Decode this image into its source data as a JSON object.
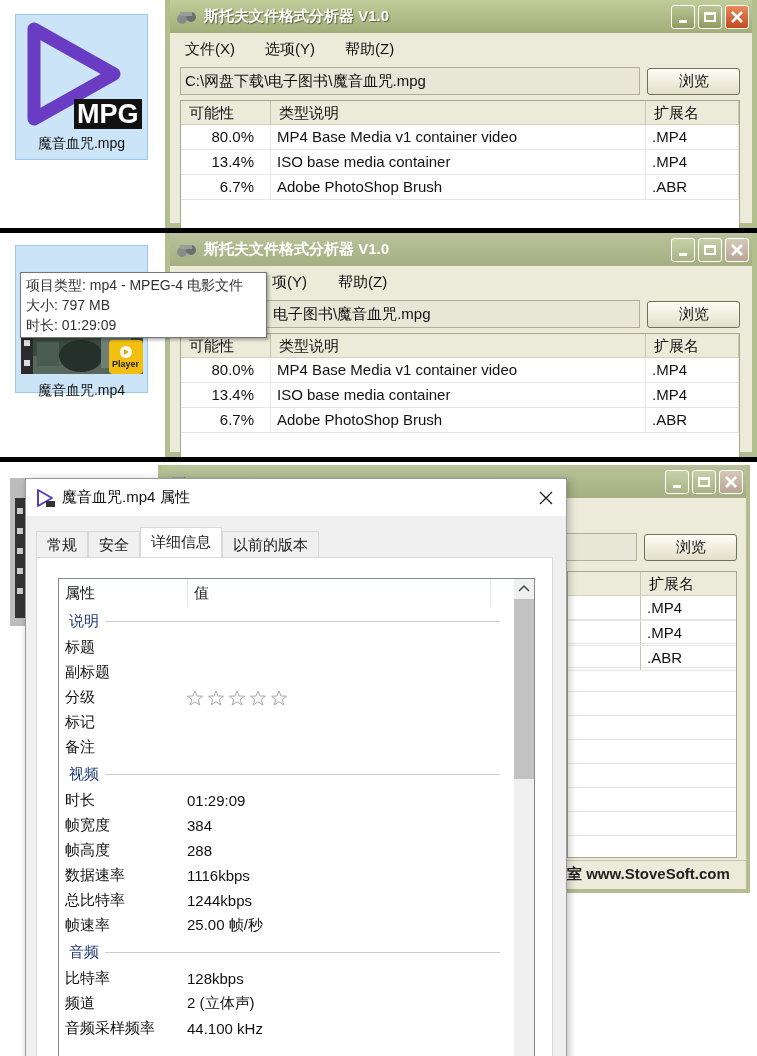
{
  "panels": [
    {
      "file_icon": {
        "kind": "mpg",
        "badge": "MPG",
        "label": "魔音血咒.mpg"
      },
      "app": {
        "title": "斯托夫文件格式分析器 V1.0",
        "active": true,
        "menu": [
          "文件(X)",
          "选项(Y)",
          "帮助(Z)"
        ],
        "path": "C:\\网盘下载\\电子图书\\魔音血咒.mpg",
        "browse": "浏览",
        "columns": [
          "可能性",
          "类型说明",
          "扩展名"
        ],
        "rows": [
          {
            "cells": [
              "80.0%",
              "MP4 Base Media v1 container video",
              ".MP4"
            ]
          },
          {
            "cells": [
              "13.4%",
              "ISO base media container",
              ".MP4"
            ]
          },
          {
            "cells": [
              "6.7%",
              "Adobe PhotoShop Brush",
              ".ABR"
            ]
          }
        ]
      }
    },
    {
      "file_icon": {
        "kind": "video",
        "badge": "Player",
        "label": "魔音血咒.mp4"
      },
      "tooltip": [
        "项目类型: mp4 - MPEG-4 电影文件",
        "大小: 797 MB",
        "时长: 01:29:09"
      ],
      "app": {
        "title": "斯托夫文件格式分析器 V1.0",
        "active": false,
        "menu": [
          "项(Y)",
          "帮助(Z)"
        ],
        "path": "电子图书\\魔音血咒.mpg",
        "browse": "浏览",
        "columns": [
          "可能性",
          "类型说明",
          "扩展名"
        ],
        "rows": [
          {
            "cells": [
              "80.0%",
              "MP4 Base Media v1 container video",
              ".MP4"
            ]
          },
          {
            "cells": [
              "13.4%",
              "ISO base media container",
              ".MP4"
            ]
          },
          {
            "cells": [
              "6.7%",
              "Adobe PhotoShop Brush",
              ".ABR"
            ]
          }
        ]
      }
    }
  ],
  "properties_screen": {
    "app": {
      "active": false,
      "browse": "浏览",
      "columns": [
        "扩展名"
      ],
      "rows": [
        {
          "cells": [
            ".MP4"
          ]
        },
        {
          "cells": [
            ".MP4"
          ]
        },
        {
          "cells": [
            ".ABR"
          ]
        }
      ],
      "status": "室 www.StoveSoft.com"
    },
    "dialog": {
      "title": "魔音血咒.mp4 属性",
      "tabs": [
        {
          "label": "常规",
          "selected": false
        },
        {
          "label": "安全",
          "selected": false
        },
        {
          "label": "详细信息",
          "selected": true
        },
        {
          "label": "以前的版本",
          "selected": false
        }
      ],
      "columns": [
        "属性",
        "值"
      ],
      "sections": [
        {
          "title": "说明",
          "rows": [
            {
              "kind": "text",
              "name": "标题"
            },
            {
              "kind": "text",
              "name": "副标题"
            },
            {
              "kind": "rating",
              "name": "分级",
              "stars": 0
            },
            {
              "kind": "text",
              "name": "标记"
            },
            {
              "kind": "text",
              "name": "备注"
            }
          ]
        },
        {
          "title": "视频",
          "rows": [
            {
              "kind": "text",
              "name": "时长",
              "value": "01:29:09"
            },
            {
              "kind": "text",
              "name": "帧宽度",
              "value": "384"
            },
            {
              "kind": "text",
              "name": "帧高度",
              "value": "288"
            },
            {
              "kind": "text",
              "name": "数据速率",
              "value": "1116kbps"
            },
            {
              "kind": "text",
              "name": "总比特率",
              "value": "1244kbps"
            },
            {
              "kind": "text",
              "name": "帧速率",
              "value": "25.00 帧/秒"
            }
          ]
        },
        {
          "title": "音频",
          "rows": [
            {
              "kind": "text",
              "name": "比特率",
              "value": "128kbps"
            },
            {
              "kind": "text",
              "name": "频道",
              "value": "2 (立体声)"
            },
            {
              "kind": "text",
              "name": "音频采样频率",
              "value": "44.100 kHz"
            }
          ]
        }
      ]
    }
  }
}
